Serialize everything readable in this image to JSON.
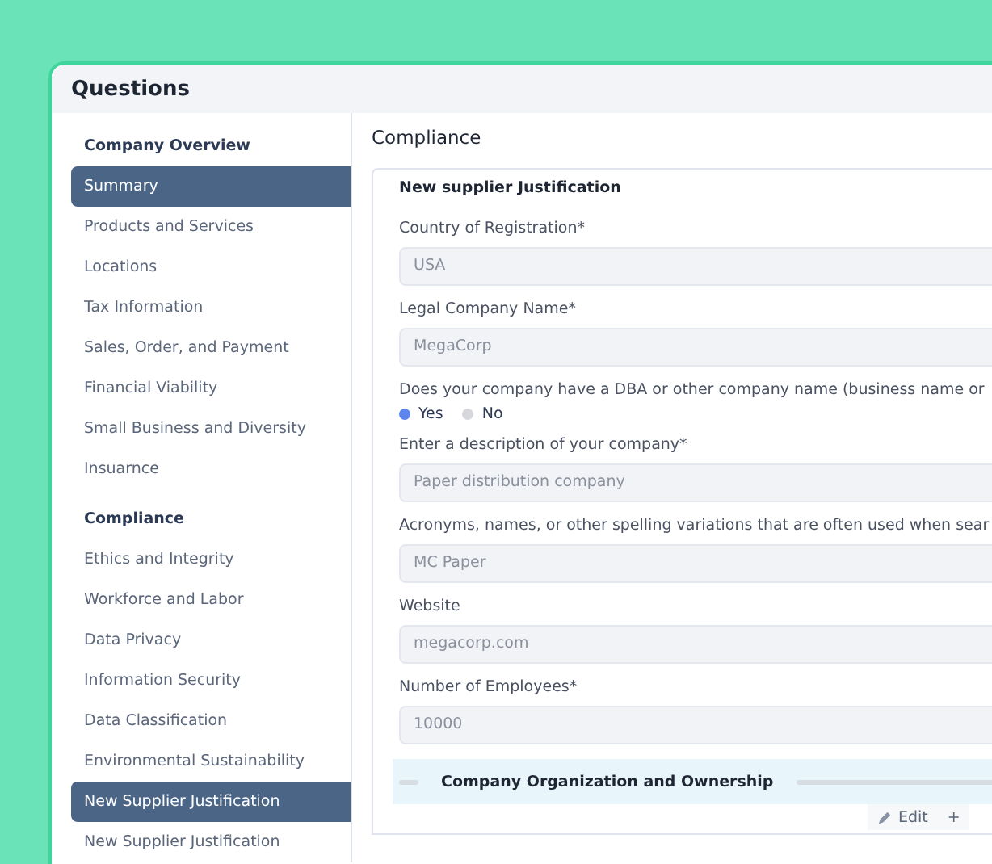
{
  "window": {
    "title": "Questions"
  },
  "sidebar": {
    "groups": [
      {
        "heading": "Company Overview",
        "items": [
          {
            "label": "Summary",
            "selected": true
          },
          {
            "label": "Products and Services",
            "selected": false
          },
          {
            "label": "Locations",
            "selected": false
          },
          {
            "label": "Tax Information",
            "selected": false
          },
          {
            "label": "Sales, Order, and Payment",
            "selected": false
          },
          {
            "label": "Financial Viability",
            "selected": false
          },
          {
            "label": "Small Business and Diversity",
            "selected": false
          },
          {
            "label": "Insuarnce",
            "selected": false
          }
        ]
      },
      {
        "heading": "Compliance",
        "items": [
          {
            "label": "Ethics and Integrity",
            "selected": false
          },
          {
            "label": "Workforce and Labor",
            "selected": false
          },
          {
            "label": "Data Privacy",
            "selected": false
          },
          {
            "label": "Information Security",
            "selected": false
          },
          {
            "label": "Data Classification",
            "selected": false
          },
          {
            "label": "Environmental Sustainability",
            "selected": false
          },
          {
            "label": "New Supplier Justification",
            "selected": true
          },
          {
            "label": "New Supplier Justification",
            "selected": false
          }
        ]
      }
    ]
  },
  "main": {
    "heading": "Compliance",
    "card": {
      "title": "New supplier Justification",
      "fields": [
        {
          "kind": "text",
          "label": "Country of Registration*",
          "value": "USA"
        },
        {
          "kind": "text",
          "label": "Legal Company Name*",
          "value": "MegaCorp"
        },
        {
          "kind": "radio",
          "label": "Does your company have a DBA or other company name (business name or",
          "options": [
            {
              "label": "Yes",
              "selected": true
            },
            {
              "label": "No",
              "selected": false
            }
          ]
        },
        {
          "kind": "text",
          "label": "Enter a description of your company*",
          "value": "Paper distribution company"
        },
        {
          "kind": "text",
          "label": "Acronyms, names, or other spelling variations that are often used when sear",
          "value": "MC Paper"
        },
        {
          "kind": "text",
          "label": "Website",
          "value": "megacorp.com"
        },
        {
          "kind": "text",
          "label": "Number of Employees*",
          "value": "10000"
        }
      ],
      "section": {
        "title": "Company Organization and Ownership"
      },
      "actions": {
        "edit": "Edit",
        "add": "+"
      }
    }
  }
}
